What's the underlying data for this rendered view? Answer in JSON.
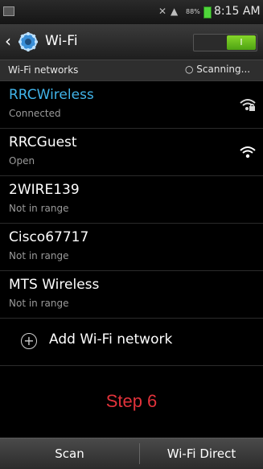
{
  "status_bar": {
    "battery_percent": "88%",
    "time": "8:15 AM",
    "icons": [
      "picture-icon",
      "mute-icon",
      "signal-icon",
      "battery-icon"
    ]
  },
  "action_bar": {
    "title": "Wi-Fi",
    "toggle_label": "I",
    "toggle_on": true,
    "accent_color": "#41b4ea"
  },
  "subheader": {
    "label": "Wi-Fi networks",
    "scanning_text": "Scanning..."
  },
  "networks": [
    {
      "name": "RRCWireless",
      "status": "Connected",
      "icon": "wifi-secured-icon"
    },
    {
      "name": "RRCGuest",
      "status": "Open",
      "icon": "wifi-icon"
    },
    {
      "name": "2WIRE139",
      "status": "Not in range"
    },
    {
      "name": "Cisco67717",
      "status": "Not in range"
    },
    {
      "name": "MTS Wireless",
      "status": "Not in range"
    }
  ],
  "add_network": {
    "label": "Add Wi-Fi network"
  },
  "annotation": {
    "text": "Step 6",
    "color": "#e0323a"
  },
  "bottom_bar": {
    "scan_label": "Scan",
    "direct_label": "Wi-Fi Direct"
  }
}
